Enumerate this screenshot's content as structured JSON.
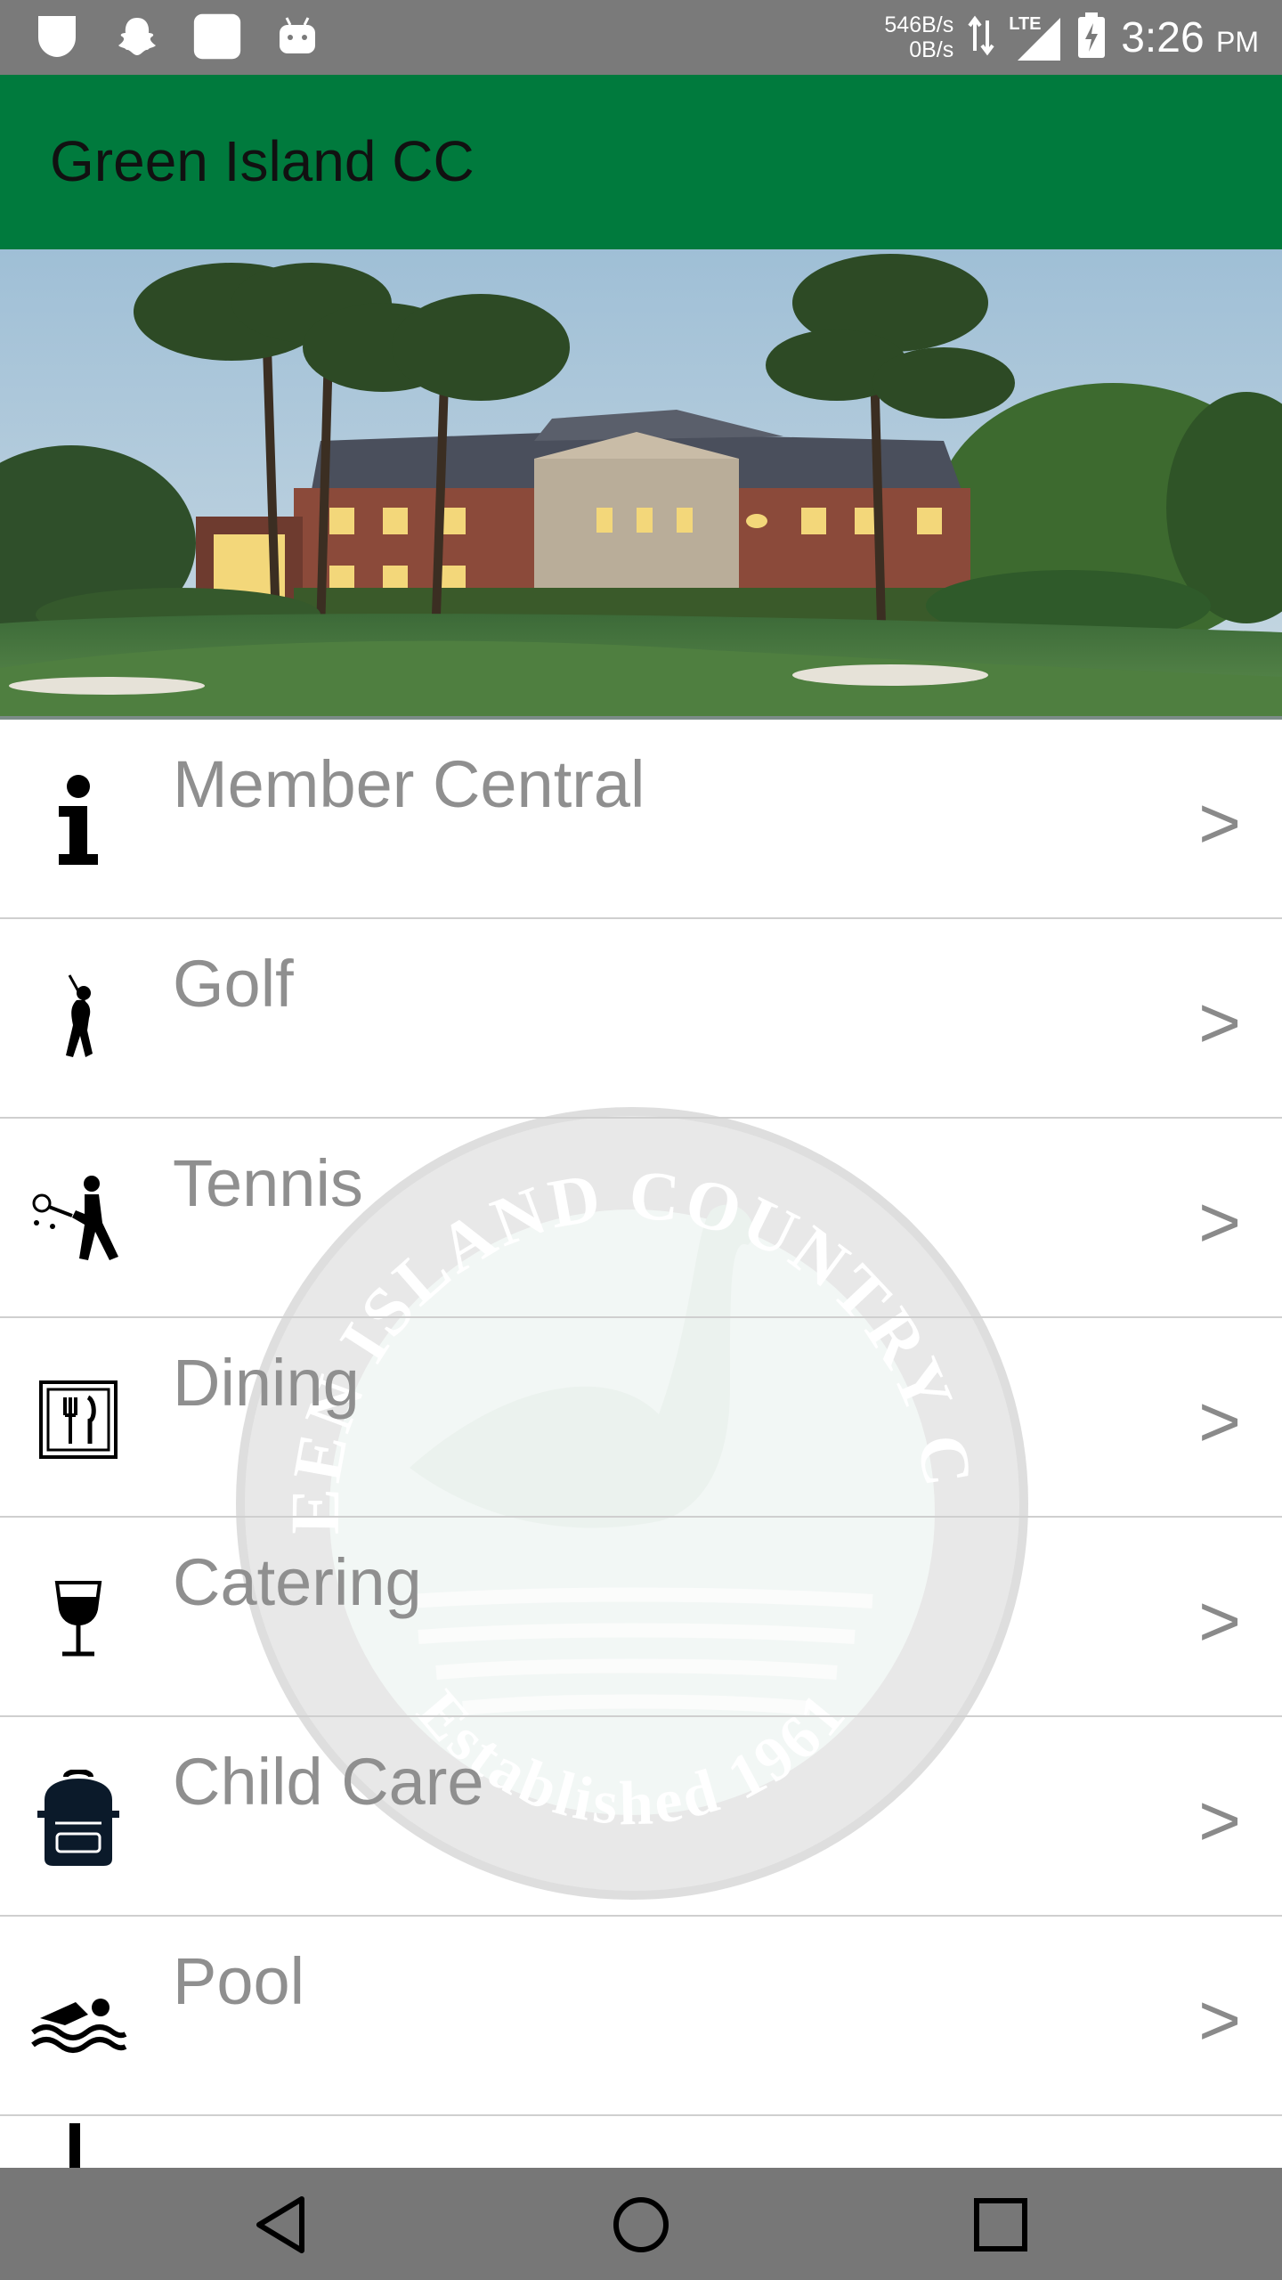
{
  "status_bar": {
    "icons": [
      "shield-icon",
      "snapchat-icon",
      "square-app-icon",
      "android-icon"
    ],
    "net_speed_up": "546B/s",
    "net_speed_down": "0B/s",
    "network_type": "LTE",
    "time": "3:26",
    "time_suffix": "PM"
  },
  "app_bar": {
    "title": "Green Island CC",
    "color": "#007a3d"
  },
  "watermark": {
    "top_text": "GREEN ISLAND COUNTRY CLUB",
    "bottom_text": "Established 1961"
  },
  "menu": {
    "chevron": ">",
    "items": [
      {
        "label": "Member Central",
        "icon": "info-icon"
      },
      {
        "label": "Golf",
        "icon": "golfer-icon"
      },
      {
        "label": "Tennis",
        "icon": "tennis-player-icon"
      },
      {
        "label": "Dining",
        "icon": "fork-knife-icon"
      },
      {
        "label": "Catering",
        "icon": "wine-glass-icon"
      },
      {
        "label": "Child Care",
        "icon": "backpack-icon"
      },
      {
        "label": "Pool",
        "icon": "swimmer-icon"
      }
    ]
  },
  "nav_bar": {
    "buttons": [
      "back-icon",
      "home-icon",
      "recents-icon"
    ]
  }
}
